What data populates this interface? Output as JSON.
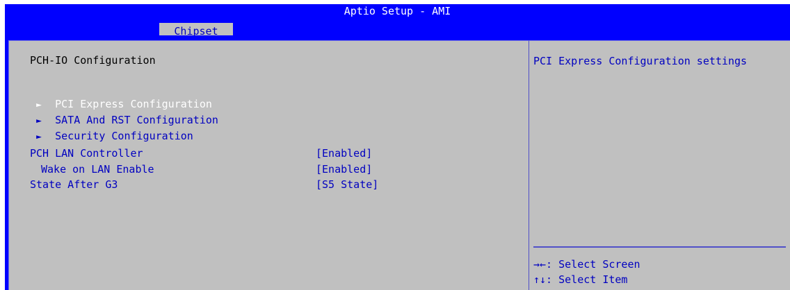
{
  "app": {
    "title": "Aptio Setup - AMI"
  },
  "tabs": [
    {
      "label": "Chipset"
    }
  ],
  "main": {
    "section_title": "PCH-IO Configuration",
    "submenus": [
      {
        "label": "PCI Express Configuration",
        "arrow": "►"
      },
      {
        "label": "SATA And RST Configuration",
        "arrow": "►"
      },
      {
        "label": "Security Configuration",
        "arrow": "►"
      }
    ],
    "settings": [
      {
        "label": "PCH LAN Controller",
        "value": "[Enabled]"
      },
      {
        "label": "Wake on LAN Enable",
        "value": "[Enabled]"
      },
      {
        "label": "State After G3",
        "value": "[S5 State]"
      }
    ]
  },
  "help": {
    "text": "PCI Express Configuration settings",
    "key_hints": [
      {
        "text": "→←: Select Screen"
      },
      {
        "text": "↑↓: Select Item"
      }
    ]
  },
  "colors": {
    "bios_blue": "#0000ff",
    "panel_gray": "#c0c0c0",
    "text_blue": "#0000c0",
    "highlight_white": "#ffffff"
  }
}
